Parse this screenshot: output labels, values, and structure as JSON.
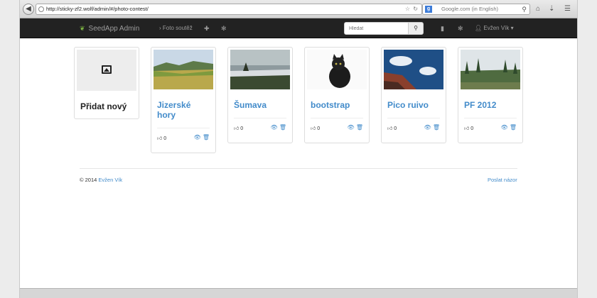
{
  "browser": {
    "url": "http://sticky-zf2.wolf/admin/#/photo-contest/",
    "search_placeholder": "Google.com (in English)"
  },
  "navbar": {
    "brand": "SeedApp Admin",
    "section": "Foto soutěž",
    "search_placeholder": "Hledat",
    "user": "Evžen Vík"
  },
  "cards": [
    {
      "title": "Přidat nový",
      "kind": "add"
    },
    {
      "title": "Jizerské hory",
      "likes": "0",
      "thumb": "meadow"
    },
    {
      "title": "Šumava",
      "likes": "0",
      "thumb": "lake"
    },
    {
      "title": "bootstrap",
      "likes": "0",
      "thumb": "cat"
    },
    {
      "title": "Pico ruivo",
      "likes": "0",
      "thumb": "clouds"
    },
    {
      "title": "PF 2012",
      "likes": "0",
      "thumb": "forest"
    }
  ],
  "footer": {
    "copyright": "© 2014",
    "author": "Evžen Vík",
    "feedback": "Poslat názor"
  },
  "colors": {
    "link": "#428bca",
    "navbar": "#222222",
    "brand_leaf": "#7cb342"
  }
}
